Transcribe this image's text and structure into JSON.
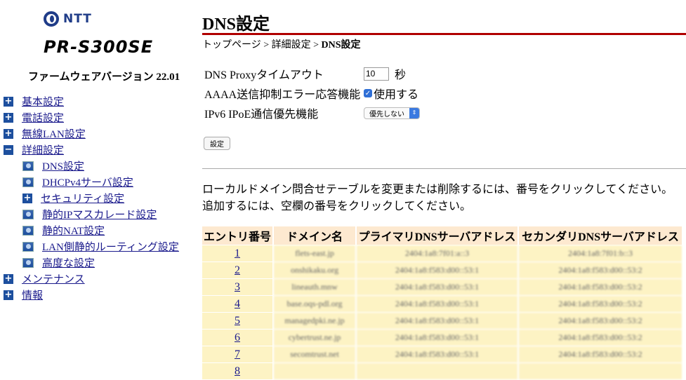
{
  "brand": {
    "name": "NTT",
    "model": "PR-S300SE",
    "firmware": "ファームウェアバージョン 22.01"
  },
  "sidebar": {
    "items": [
      {
        "label": "基本設定",
        "level": 1,
        "icon": "plus-icon"
      },
      {
        "label": "電話設定",
        "level": 1,
        "icon": "plus-icon"
      },
      {
        "label": "無線LAN設定",
        "level": 1,
        "icon": "plus-icon"
      },
      {
        "label": "詳細設定",
        "level": 1,
        "icon": "minus-icon"
      },
      {
        "label": "DNS設定",
        "level": 2,
        "icon": "page-bullet-icon"
      },
      {
        "label": "DHCPv4サーバ設定",
        "level": 2,
        "icon": "page-bullet-icon"
      },
      {
        "label": "セキュリティ設定",
        "level": 2,
        "icon": "plus-icon"
      },
      {
        "label": "静的IPマスカレード設定",
        "level": 2,
        "icon": "page-bullet-icon"
      },
      {
        "label": "静的NAT設定",
        "level": 2,
        "icon": "page-bullet-icon"
      },
      {
        "label": "LAN側静的ルーティング設定",
        "level": 2,
        "icon": "page-bullet-icon"
      },
      {
        "label": "高度な設定",
        "level": 2,
        "icon": "page-bullet-icon"
      },
      {
        "label": "メンテナンス",
        "level": 1,
        "icon": "plus-icon"
      },
      {
        "label": "情報",
        "level": 1,
        "icon": "plus-icon"
      }
    ]
  },
  "page": {
    "title": "DNS設定",
    "breadcrumb": {
      "home": "トップページ",
      "sep": " > ",
      "parent": "詳細設定",
      "current": "DNS設定"
    }
  },
  "form": {
    "proxy_timeout_label": "DNS Proxyタイムアウト",
    "proxy_timeout_value": "10",
    "proxy_timeout_unit": "秒",
    "aaaa_label": "AAAA送信抑制エラー応答機能",
    "aaaa_checkbox_label": "使用する",
    "ipv6_label": "IPv6 IPoE通信優先機能",
    "ipv6_selected": "優先しない",
    "submit_label": "設定"
  },
  "description": {
    "line1": "ローカルドメイン問合せテーブルを変更または削除するには、番号をクリックしてください。",
    "line2": "追加するには、空欄の番号をクリックしてください。"
  },
  "table": {
    "headers": [
      "エントリ番号",
      "ドメイン名",
      "プライマリDNSサーバアドレス",
      "セカンダリDNSサーバアドレス"
    ],
    "rows": [
      {
        "idx": "1",
        "domain": "flets-east.jp",
        "primary": "2404:1a8:7f01:a::3",
        "secondary": "2404:1a8:7f01:b::3"
      },
      {
        "idx": "2",
        "domain": "onshikaku.org",
        "primary": "2404:1a8:f583:d00::53:1",
        "secondary": "2404:1a8:f583:d00::53:2"
      },
      {
        "idx": "3",
        "domain": "lineauth.mnw",
        "primary": "2404:1a8:f583:d00::53:1",
        "secondary": "2404:1a8:f583:d00::53:2"
      },
      {
        "idx": "4",
        "domain": "base.oqs-pdl.org",
        "primary": "2404:1a8:f583:d00::53:1",
        "secondary": "2404:1a8:f583:d00::53:2"
      },
      {
        "idx": "5",
        "domain": "managedpki.ne.jp",
        "primary": "2404:1a8:f583:d00::53:1",
        "secondary": "2404:1a8:f583:d00::53:2"
      },
      {
        "idx": "6",
        "domain": "cybertrust.ne.jp",
        "primary": "2404:1a8:f583:d00::53:1",
        "secondary": "2404:1a8:f583:d00::53:2"
      },
      {
        "idx": "7",
        "domain": "secomtrust.net",
        "primary": "2404:1a8:f583:d00::53:1",
        "secondary": "2404:1a8:f583:d00::53:2"
      },
      {
        "idx": "8",
        "domain": "",
        "primary": "",
        "secondary": ""
      }
    ]
  }
}
